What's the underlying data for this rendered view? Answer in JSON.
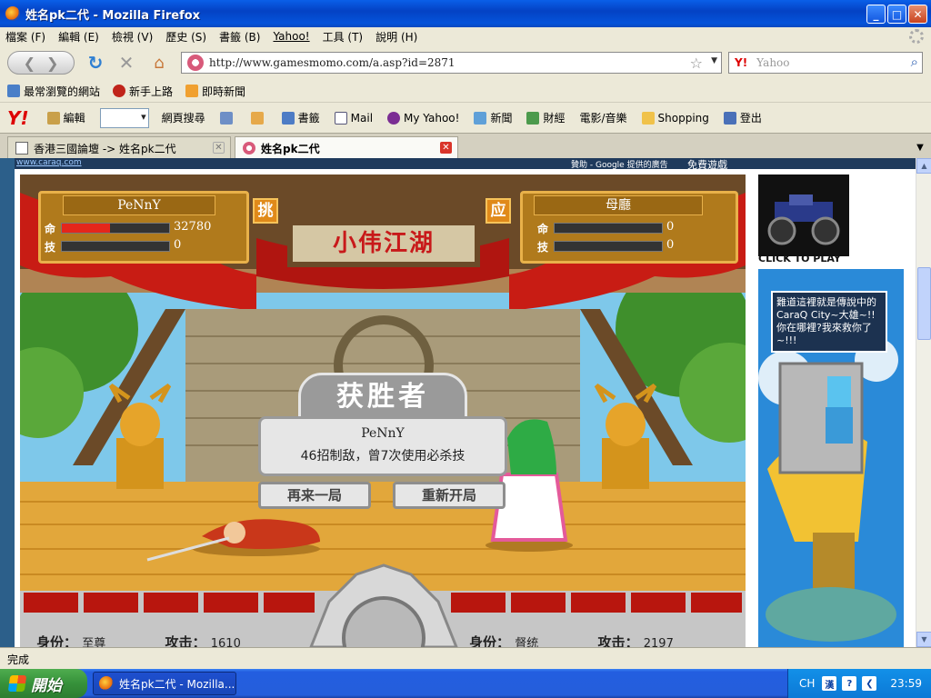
{
  "window": {
    "title": "姓名pk二代 - Mozilla Firefox"
  },
  "menu": [
    "檔案 (F)",
    "編輯 (E)",
    "檢視 (V)",
    "歷史 (S)",
    "書籤 (B)",
    "Yahoo!",
    "工具 (T)",
    "說明 (H)"
  ],
  "nav": {
    "url": "http://www.gamesmomo.com/a.asp?id=2871",
    "search_engine": "Y!",
    "search_placeholder": "Yahoo"
  },
  "bookmarks": [
    "最常瀏覽的網站",
    "新手上路",
    "即時新聞"
  ],
  "yahoo_toolbar": {
    "logo": "Y!",
    "items": [
      "編輯",
      "網頁搜尋",
      "書籤",
      "Mail",
      "My Yahoo!",
      "新聞",
      "財經",
      "電影/音樂",
      "Shopping",
      "登出"
    ]
  },
  "tabs": [
    {
      "label": "香港三國論壇 -> 姓名pk二代"
    },
    {
      "label": "姓名pk二代"
    }
  ],
  "page_header": {
    "site_link": "www.caraq.com",
    "ads_label": "贊助 - Google 提供的廣告",
    "free_games": "免費遊戲"
  },
  "game": {
    "sign": "小伟江湖",
    "left_tag": "挑",
    "right_tag": "应",
    "player1": {
      "name": "PeNnY",
      "hp_label": "命",
      "sp_label": "技",
      "hp_value": "32780",
      "sp_value": "0",
      "hp_fraction": 0.45,
      "sp_fraction": 0
    },
    "player2": {
      "name": "母廳",
      "hp_label": "命",
      "sp_label": "技",
      "hp_value": "0",
      "sp_value": "0",
      "hp_fraction": 0,
      "sp_fraction": 0
    },
    "winner_title": "获胜者",
    "winner_name": "PeNnY",
    "winner_desc": "46招制敌，曾7次使用必杀技",
    "btn_replay": "再来一局",
    "btn_restart": "重新开局",
    "skills_left": [
      "",
      "",
      "",
      "",
      ""
    ],
    "skills_right": [
      "",
      "",
      "",
      "",
      ""
    ],
    "stats_left": {
      "identity_label": "身份：",
      "identity_value": "至尊",
      "attack_label": "攻击：",
      "attack_value": "1610"
    },
    "stats_right": {
      "identity_label": "身份：",
      "identity_value": "督统",
      "attack_label": "攻击：",
      "attack_value": "2197"
    }
  },
  "side_ad": {
    "click": "CLICK TO PLAY",
    "bubble": "難道這裡就是傳說中的CaraQ City~大雄~!!你在哪裡?我來救你了~!!!"
  },
  "status": "完成",
  "taskbar": {
    "start": "開始",
    "window": "姓名pk二代 - Mozilla...",
    "lang": "CH",
    "clock": "23:59"
  }
}
